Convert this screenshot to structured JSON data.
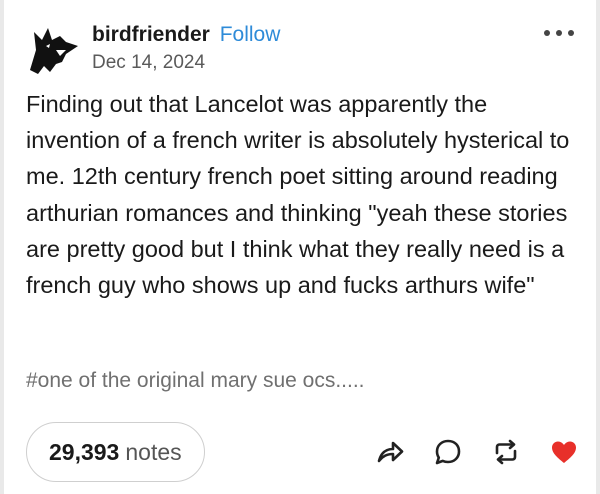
{
  "post": {
    "username": "birdfriender",
    "follow_label": "Follow",
    "date": "Dec 14, 2024",
    "body": "Finding out that Lancelot was apparently the invention of a french writer is absolutely hysterical to me. 12th century french poet sitting around reading arthurian romances and thinking \"yeah these stories are pretty good but I think what they really need is a french guy who shows up and fucks arthurs wife\"",
    "tags": "#one of the original mary sue ocs.....",
    "notes_count": "29,393",
    "notes_label": "notes"
  },
  "icons": {
    "avatar": "wolf-avatar",
    "more": "more-horizontal-icon",
    "share": "share-icon",
    "reply": "reply-icon",
    "reblog": "reblog-icon",
    "like": "heart-icon"
  },
  "colors": {
    "follow": "#2e8bd8",
    "like": "#e8302a",
    "text": "#1a1a1a",
    "muted": "#707070"
  }
}
